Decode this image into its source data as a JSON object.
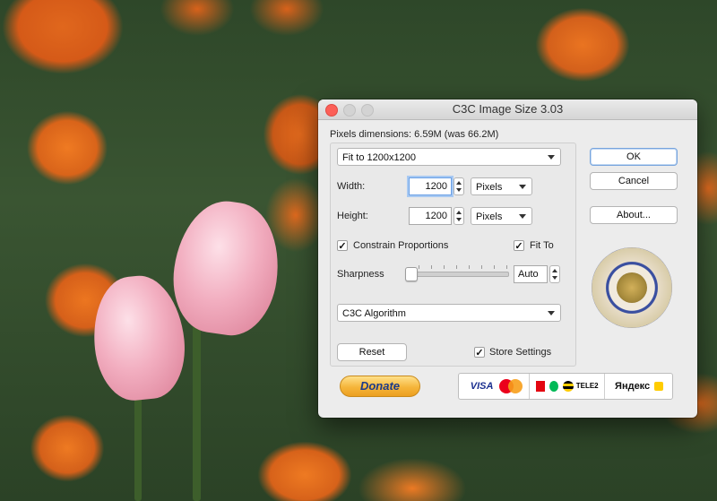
{
  "window": {
    "title": "C3C Image Size 3.03"
  },
  "pixels_dimensions": "Pixels dimensions: 6.59M  (was 66.2M)",
  "fit_popup": {
    "value": "Fit to 1200x1200"
  },
  "width": {
    "label": "Width:",
    "value": "1200",
    "unit": "Pixels"
  },
  "height": {
    "label": "Height:",
    "value": "1200",
    "unit": "Pixels"
  },
  "constrain": {
    "label": "Constrain Proportions",
    "checked": true,
    "mark": "✓"
  },
  "fit_to": {
    "label": "Fit To",
    "checked": true,
    "mark": "✓"
  },
  "sharpness": {
    "label": "Sharpness",
    "value": "Auto",
    "level": 0.0
  },
  "algorithm": {
    "value": "C3C Algorithm"
  },
  "buttons": {
    "ok": "OK",
    "cancel": "Cancel",
    "about": "About...",
    "reset": "Reset"
  },
  "store_settings": {
    "label": "Store Settings",
    "checked": true,
    "mark": "✓"
  },
  "donate_label": "Donate",
  "payments": {
    "visa": "VISA",
    "beeline_text": "ТЕLE2",
    "yandex": "Яндекс"
  },
  "colors": {
    "accent_blue": "#77a4dd",
    "donate_orange": "#f5b53a",
    "close_red": "#fc5f57"
  }
}
